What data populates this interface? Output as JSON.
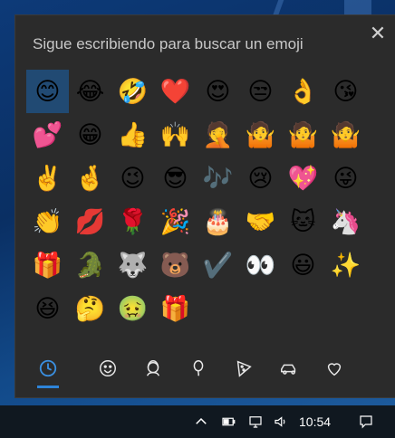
{
  "search": {
    "prompt": "Sigue escribiendo para buscar un emoji"
  },
  "close_glyph": "✕",
  "emoji_grid": [
    "😊",
    "😂",
    "🤣",
    "❤️",
    "😍",
    "😒",
    "👌",
    "😘",
    "💕",
    "😁",
    "👍",
    "🙌",
    "🤦",
    "🤷",
    "🤷",
    "🤷",
    "✌️",
    "🤞",
    "😉",
    "😎",
    "🎶",
    "😢",
    "💖",
    "😜",
    "👏",
    "💋",
    "🌹",
    "🎉",
    "🎂",
    "🤝",
    "🐱",
    "🦄",
    "🎁",
    "🐊",
    "🐺",
    "🐻",
    "✔️",
    "👀",
    "😃",
    "✨",
    "😆",
    "🤔",
    "🤢",
    "🎁"
  ],
  "selected_index": 0,
  "tabs": [
    {
      "icon": "clock-icon",
      "active": true
    },
    {
      "icon": "smiley-icon",
      "active": false
    },
    {
      "icon": "person-icon",
      "active": false
    },
    {
      "icon": "balloon-icon",
      "active": false
    },
    {
      "icon": "pizza-icon",
      "active": false
    },
    {
      "icon": "car-icon",
      "active": false
    },
    {
      "icon": "heart-icon",
      "active": false
    }
  ],
  "taskbar": {
    "time": "10:54"
  },
  "colors": {
    "panel": "#2b2b2b",
    "selected": "#214a73",
    "accent": "#2e84d8",
    "taskbar": "#101820"
  }
}
